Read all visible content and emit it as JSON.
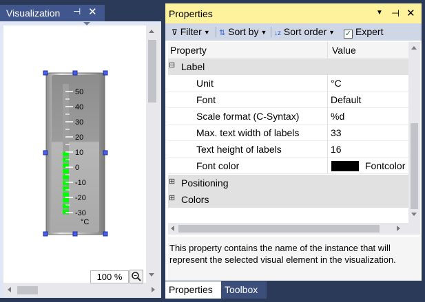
{
  "visualization": {
    "title": "Visualization",
    "zoom": "100 %",
    "thermometer": {
      "scale_labels": [
        "50",
        "40",
        "30",
        "20",
        "10",
        "0",
        "-10",
        "-20",
        "-30"
      ],
      "unit": "°C",
      "min": -30,
      "max": 50,
      "value": 10,
      "fill_color": "#00ff00"
    }
  },
  "properties": {
    "title": "Properties",
    "toolbar": {
      "filter": "Filter",
      "sort_by": "Sort by",
      "sort_order": "Sort order",
      "expert": "Expert",
      "expert_checked": true
    },
    "grid": {
      "col_property": "Property",
      "col_value": "Value",
      "category_label": "Label",
      "rows": [
        {
          "name": "Unit",
          "value": "°C"
        },
        {
          "name": "Font",
          "value": "Default"
        },
        {
          "name": "Scale format (C-Syntax)",
          "value": "%d"
        },
        {
          "name": "Max. text width of labels",
          "value": "33"
        },
        {
          "name": "Text height of labels",
          "value": "16"
        },
        {
          "name": "Font color",
          "value": "Fontcolor",
          "swatch": "#000000"
        }
      ],
      "category_positioning": "Positioning",
      "category_colors": "Colors"
    },
    "description": "This property contains the name of the instance that will represent the selected visual element in the visualization.",
    "tabs": [
      "Properties",
      "Toolbox"
    ]
  }
}
